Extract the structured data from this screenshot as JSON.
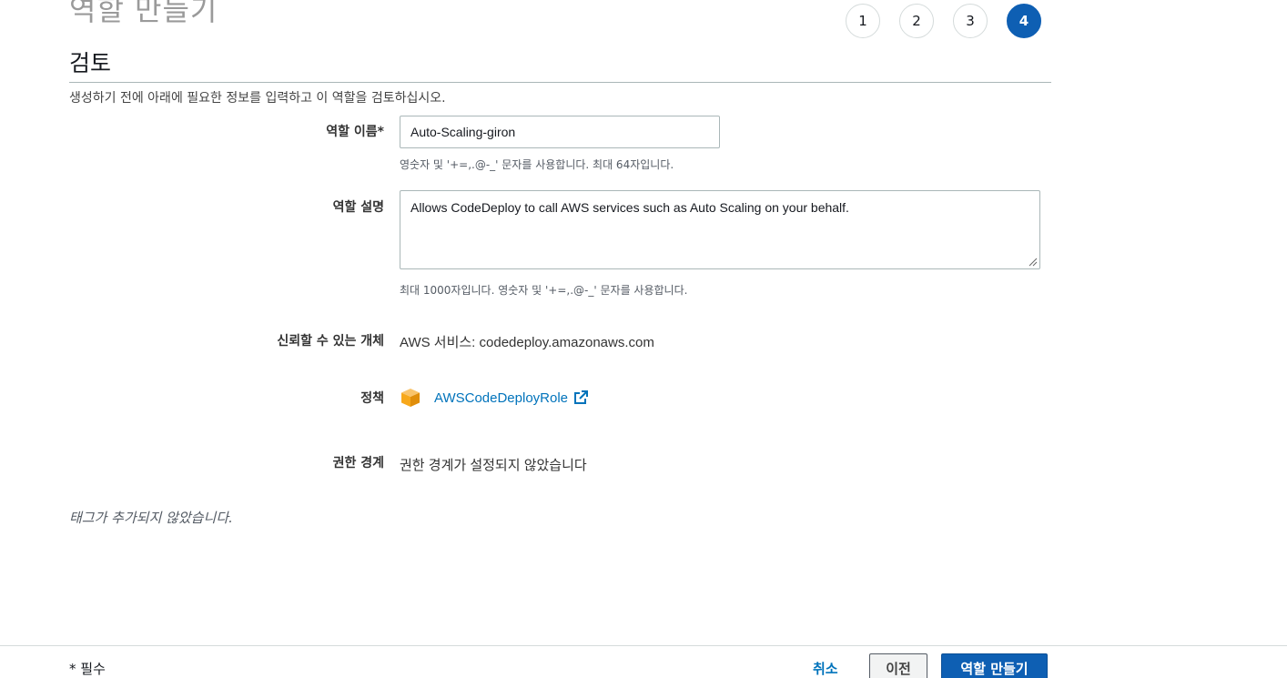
{
  "header": {
    "title": "역할 만들기",
    "steps": [
      "1",
      "2",
      "3",
      "4"
    ],
    "active_step": "4"
  },
  "review": {
    "section_title": "검토",
    "intro": "생성하기 전에 아래에 필요한 정보를 입력하고 이 역할을 검토하십시오."
  },
  "role_name": {
    "label": "역할 이름*",
    "value": "Auto-Scaling-giron",
    "hint": "영숫자 및 '+=,.@-_' 문자를 사용합니다. 최대 64자입니다."
  },
  "role_description": {
    "label": "역할 설명",
    "value": "Allows CodeDeploy to call AWS services such as Auto Scaling on your behalf.",
    "hint": "최대 1000자입니다. 영숫자 및 '+=,.@-_' 문자를 사용합니다."
  },
  "trusted_entity": {
    "label": "신뢰할 수 있는 개체",
    "value": "AWS 서비스: codedeploy.amazonaws.com"
  },
  "policies": {
    "label": "정책",
    "items": [
      {
        "name": "AWSCodeDeployRole",
        "icon": "policy-box-icon"
      }
    ]
  },
  "permissions_boundary": {
    "label": "권한 경계",
    "value": "권한 경계가 설정되지 않았습니다"
  },
  "tags_note": "태그가 추가되지 않았습니다.",
  "footer": {
    "required_note": "* 필수",
    "cancel_label": "취소",
    "prev_label": "이전",
    "create_label": "역할 만들기"
  },
  "colors": {
    "accent": "#0e5fb3",
    "link": "#0073bb",
    "policy_icon": "#f7a81b"
  }
}
